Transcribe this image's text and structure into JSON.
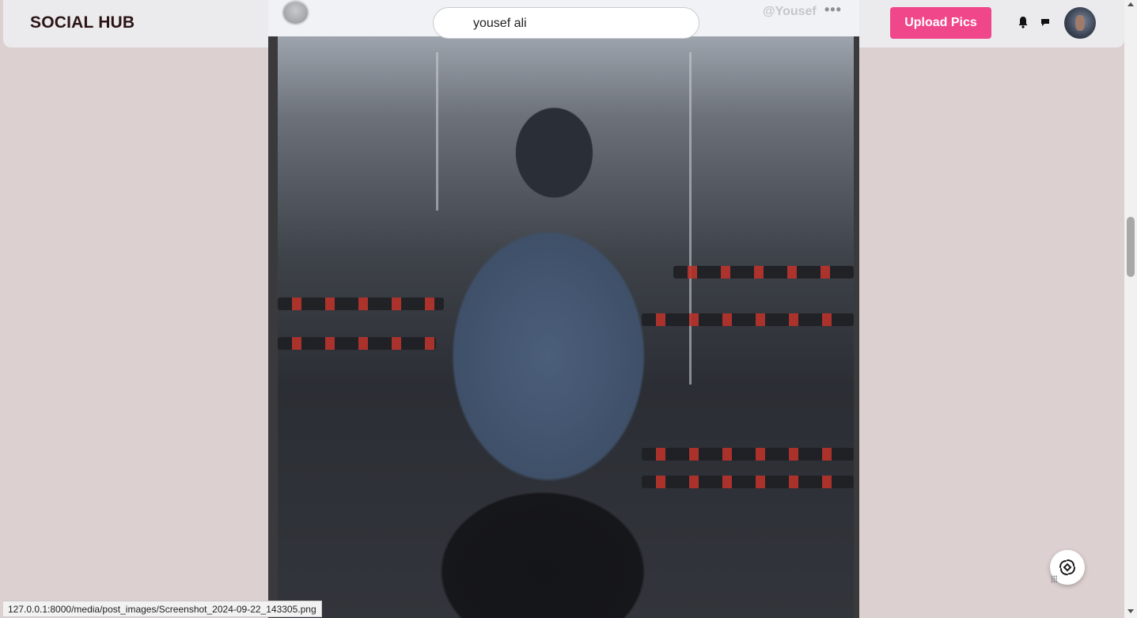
{
  "app": {
    "title": "SOCIAL HUB"
  },
  "search": {
    "value": "yousef ali",
    "placeholder": ""
  },
  "header": {
    "upload_label": "Upload Pics"
  },
  "icons": {
    "notifications": "bell-icon",
    "messages": "chat-icon",
    "post_menu": "more-horizontal-icon",
    "assistant": "assistant-icon"
  },
  "post": {
    "username": "@Yousef",
    "menu_glyph": "•••",
    "image_alt": "gym mirror selfie"
  },
  "status_bar": {
    "url": "127.0.0.1:8000/media/post_images/Screenshot_2024-09-22_143305.png"
  },
  "colors": {
    "page_background": "#ddd0d0",
    "navbar_background": "#ebebee",
    "accent": "#f0468a",
    "logo_text": "#2b1414"
  }
}
